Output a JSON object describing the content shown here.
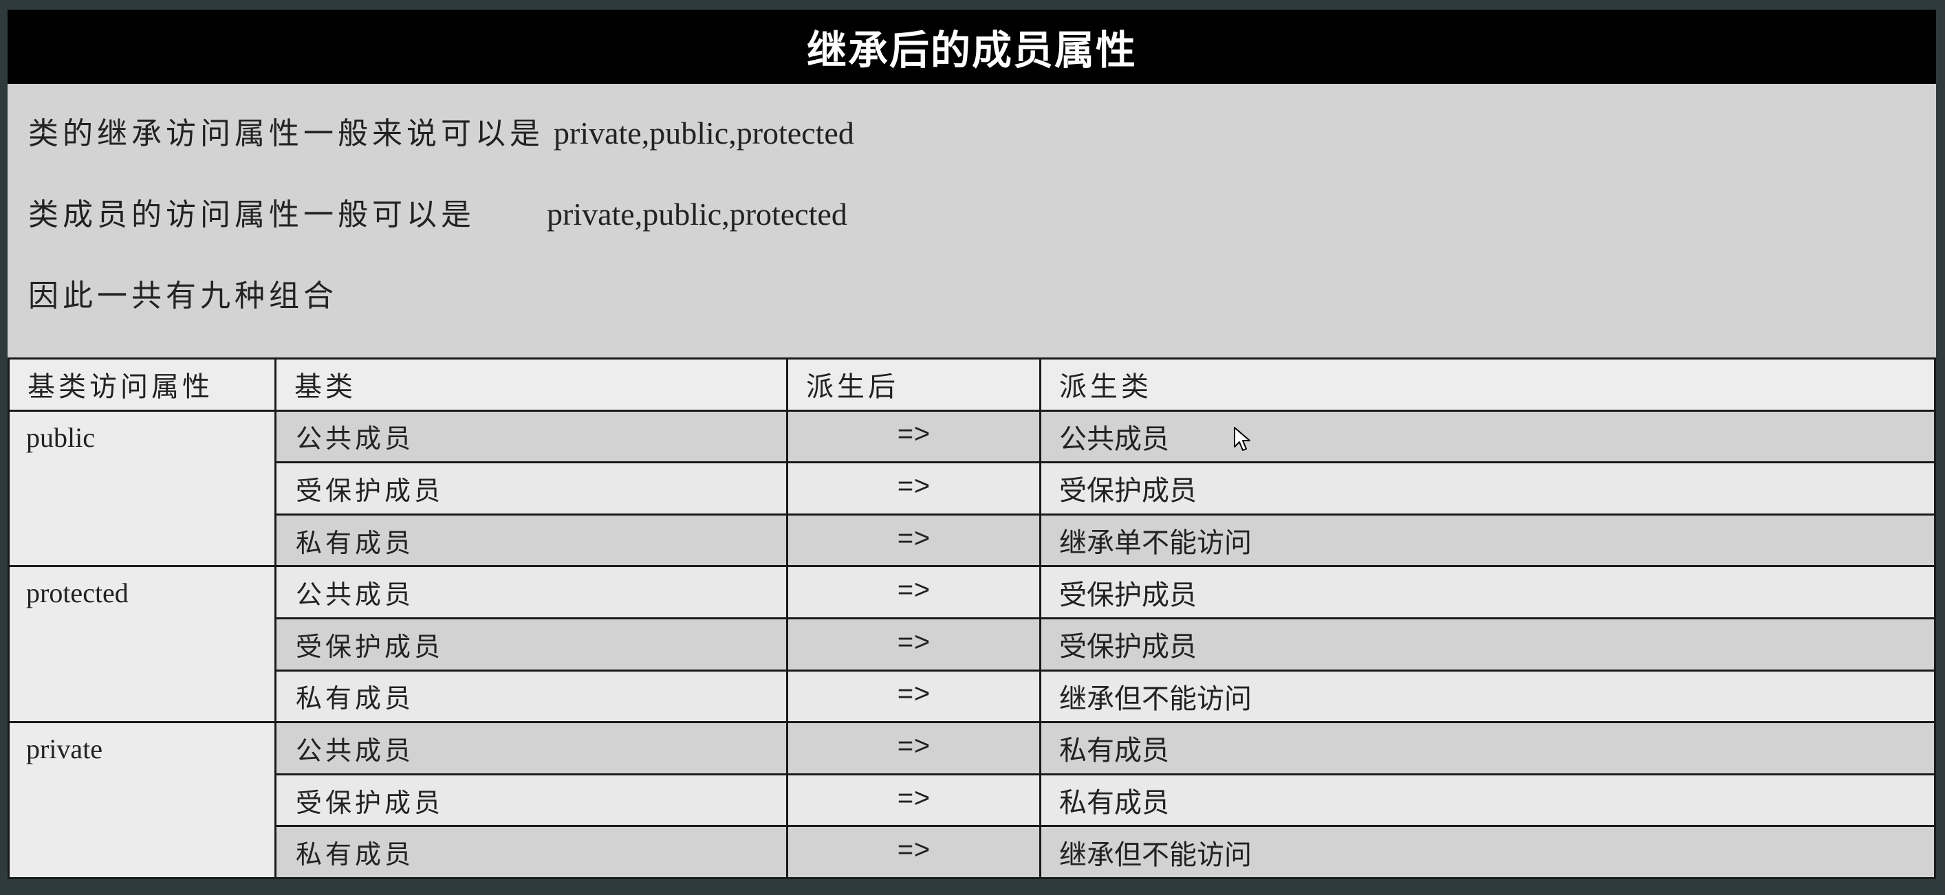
{
  "title": "继承后的成员属性",
  "intro": {
    "line1_zh": "类的继承访问属性一般来说可以是",
    "line1_en": "private,public,protected",
    "line2_zh": "类成员的访问属性一般可以是",
    "line2_en": "private,public,protected",
    "line3": "因此一共有九种组合"
  },
  "table": {
    "headers": [
      "基类访问属性",
      "基类",
      "派生后",
      "派生类"
    ],
    "groups": [
      {
        "access": "public",
        "rows": [
          {
            "base": "公共成员",
            "arrow": "=>",
            "derived": "公共成员"
          },
          {
            "base": "受保护成员",
            "arrow": "=>",
            "derived": "受保护成员"
          },
          {
            "base": "私有成员",
            "arrow": "=>",
            "derived": "继承单不能访问"
          }
        ]
      },
      {
        "access": "protected",
        "rows": [
          {
            "base": "公共成员",
            "arrow": "=>",
            "derived": "受保护成员"
          },
          {
            "base": "受保护成员",
            "arrow": "=>",
            "derived": "受保护成员"
          },
          {
            "base": "私有成员",
            "arrow": "=>",
            "derived": "继承但不能访问"
          }
        ]
      },
      {
        "access": "private",
        "rows": [
          {
            "base": "公共成员",
            "arrow": "=>",
            "derived": "私有成员"
          },
          {
            "base": "受保护成员",
            "arrow": "=>",
            "derived": "私有成员"
          },
          {
            "base": "私有成员",
            "arrow": "=>",
            "derived": "继承但不能访问"
          }
        ]
      }
    ]
  },
  "icons": {
    "cursor": "mouse-pointer-icon"
  },
  "colors": {
    "title_bg": "#000000",
    "title_fg": "#ffffff",
    "slide_bg": "#d3d3d3",
    "row_dark": "#d2d2d2",
    "row_light": "#e9e9e9",
    "header_bg": "#ededed",
    "frame_bg": "#2e3b3d"
  }
}
